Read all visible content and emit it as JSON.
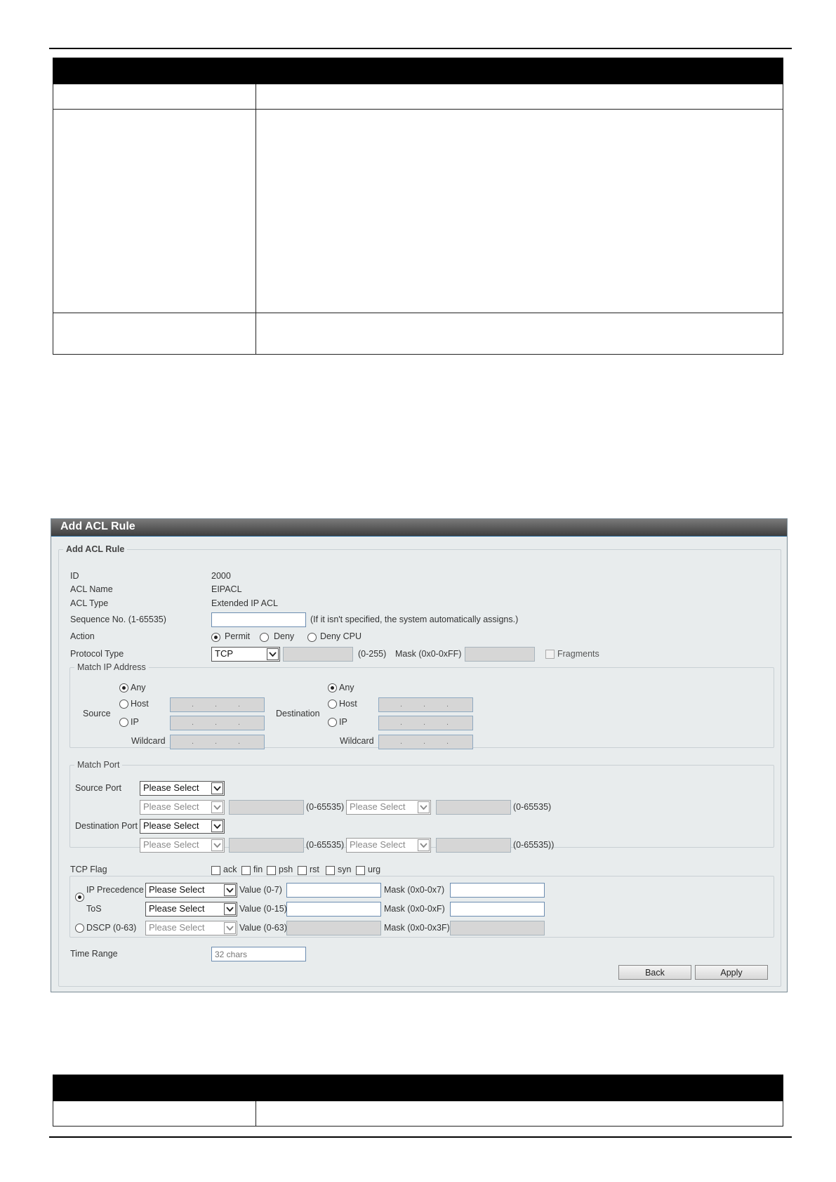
{
  "panel": {
    "title": "Add ACL Rule",
    "legend": "Add ACL Rule",
    "fields": {
      "id_label": "ID",
      "id_value": "2000",
      "acl_name_label": "ACL Name",
      "acl_name_value": "EIPACL",
      "acl_type_label": "ACL Type",
      "acl_type_value": "Extended IP ACL",
      "sequence_label": "Sequence No. (1-65535)",
      "sequence_hint": "(If it isn't specified, the system automatically assigns.)",
      "action_label": "Action",
      "action_options": [
        "Permit",
        "Deny",
        "Deny CPU"
      ],
      "action_selected": "Permit",
      "protocol_label": "Protocol Type",
      "protocol_value": "TCP",
      "protocol_range": "(0-255)",
      "protocol_mask_label": "Mask (0x0-0xFF)",
      "fragments_label": "Fragments"
    },
    "match_ip": {
      "legend": "Match IP Address",
      "source_label": "Source",
      "destination_label": "Destination",
      "any_label": "Any",
      "host_label": "Host",
      "ip_label": "IP",
      "wildcard_label": "Wildcard",
      "ip_dots": "."
    },
    "match_port": {
      "legend": "Match Port",
      "source_port_label": "Source Port",
      "destination_port_label": "Destination Port",
      "select_placeholder": "Please Select",
      "range1": "(0-65535)",
      "range2": "(0-65535)",
      "range3": "(0-65535)",
      "range4": "(0-65535))"
    },
    "tcp_flag": {
      "label": "TCP Flag",
      "flags": [
        "ack",
        "fin",
        "psh",
        "rst",
        "syn",
        "urg"
      ]
    },
    "qos": {
      "ip_precedence_label": "IP Precedence",
      "tos_label": "ToS",
      "dscp_label": "DSCP (0-63)",
      "select_placeholder": "Please Select",
      "value_0_7": "Value (0-7)",
      "mask_0_7": "Mask (0x0-0x7)",
      "value_0_15": "Value (0-15)",
      "mask_0_f": "Mask (0x0-0xF)",
      "value_0_63": "Value (0-63)",
      "mask_0_3f": "Mask (0x0-0x3F)"
    },
    "time_range": {
      "label": "Time Range",
      "placeholder": "32 chars"
    },
    "buttons": {
      "back": "Back",
      "apply": "Apply"
    }
  }
}
